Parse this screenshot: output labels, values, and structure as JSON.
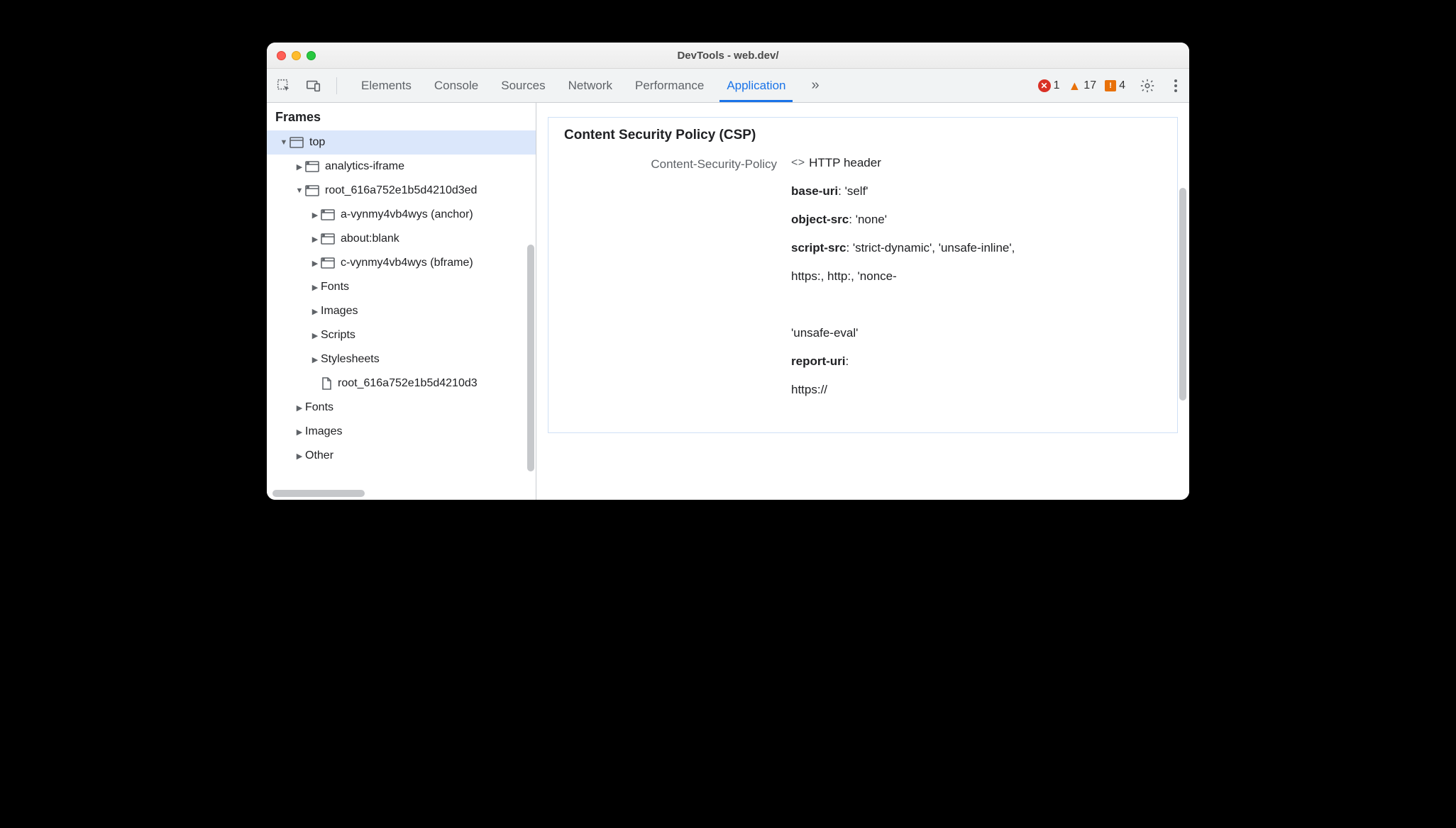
{
  "window": {
    "title": "DevTools - web.dev/"
  },
  "toolbar": {
    "tabs": [
      "Elements",
      "Console",
      "Sources",
      "Network",
      "Performance",
      "Application"
    ],
    "active_tab": "Application",
    "more_glyph": "»",
    "errors": 1,
    "warnings": 17,
    "issues": 4
  },
  "sidebar": {
    "title": "Frames",
    "tree": [
      {
        "indent": 0,
        "arrow": "▼",
        "icon": "window",
        "label": "top",
        "selected": true
      },
      {
        "indent": 1,
        "arrow": "▶",
        "icon": "frame",
        "label": "analytics-iframe"
      },
      {
        "indent": 1,
        "arrow": "▼",
        "icon": "frame",
        "label": "root_616a752e1b5d4210d3ed"
      },
      {
        "indent": 2,
        "arrow": "▶",
        "icon": "frame",
        "label": "a-vynmy4vb4wys (anchor)"
      },
      {
        "indent": 2,
        "arrow": "▶",
        "icon": "frame",
        "label": "about:blank"
      },
      {
        "indent": 2,
        "arrow": "▶",
        "icon": "frame",
        "label": "c-vynmy4vb4wys (bframe)"
      },
      {
        "indent": 2,
        "arrow": "▶",
        "icon": "",
        "label": "Fonts"
      },
      {
        "indent": 2,
        "arrow": "▶",
        "icon": "",
        "label": "Images"
      },
      {
        "indent": 2,
        "arrow": "▶",
        "icon": "",
        "label": "Scripts"
      },
      {
        "indent": 2,
        "arrow": "▶",
        "icon": "",
        "label": "Stylesheets"
      },
      {
        "indent": 2,
        "arrow": "",
        "icon": "doc",
        "label": "root_616a752e1b5d4210d3"
      },
      {
        "indent": 1,
        "arrow": "▶",
        "icon": "",
        "label": "Fonts"
      },
      {
        "indent": 1,
        "arrow": "▶",
        "icon": "",
        "label": "Images"
      },
      {
        "indent": 1,
        "arrow": "▶",
        "icon": "",
        "label": "Other"
      }
    ]
  },
  "csp": {
    "panel_title": "Content Security Policy (CSP)",
    "key": "Content-Security-Policy",
    "http_header_label": "HTTP header",
    "directives": [
      {
        "k": "base-uri",
        "v": ": 'self'"
      },
      {
        "k": "object-src",
        "v": ": 'none'"
      },
      {
        "k": "script-src",
        "v": ": 'strict-dynamic', 'unsafe-inline',"
      },
      {
        "k": "",
        "v": "https:, http:, 'nonce-"
      },
      {
        "k": "",
        "v": ""
      },
      {
        "k": "",
        "v": "'unsafe-eval'"
      },
      {
        "k": "report-uri",
        "v": ":"
      },
      {
        "k": "",
        "v": "https://"
      }
    ]
  }
}
